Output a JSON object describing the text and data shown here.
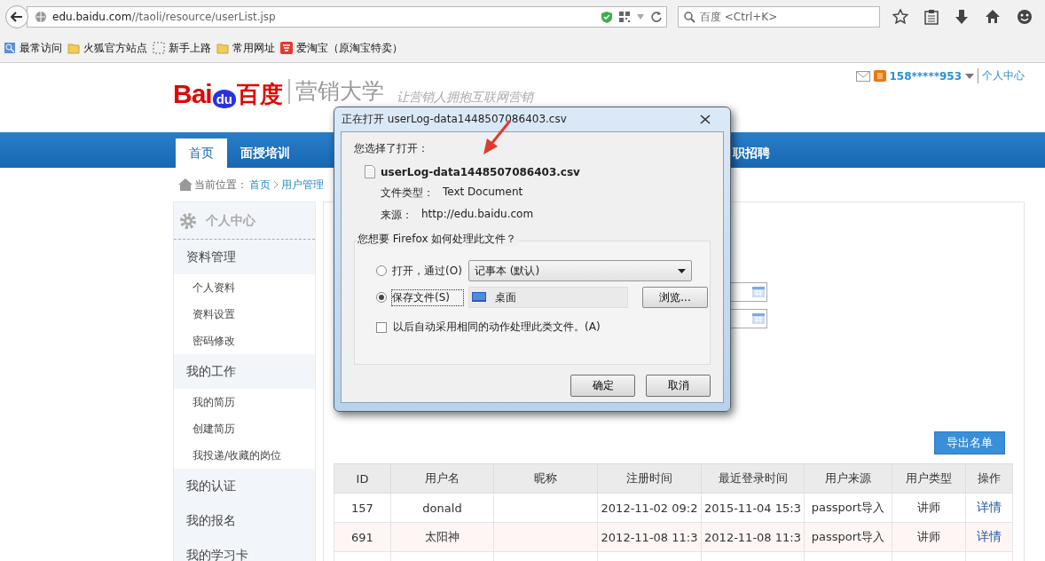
{
  "browser": {
    "url_host": "edu.baidu.com",
    "url_path": "//taoli/resource/userList.jsp",
    "search_placeholder": "百度 <Ctrl+K>",
    "bookmarks": [
      {
        "label": "最常访问",
        "kind": "smart"
      },
      {
        "label": "火狐官方站点",
        "kind": "folder"
      },
      {
        "label": "新手上路",
        "kind": "page"
      },
      {
        "label": "常用网址",
        "kind": "folder"
      },
      {
        "label": "爱淘宝（原淘宝特卖）",
        "kind": "shop"
      }
    ]
  },
  "header": {
    "logo_left": "Bai",
    "logo_paw": "du",
    "logo_right": "百度",
    "site": "营销大学",
    "slogan": "让营销人拥抱互联网营销",
    "user": "158*****953",
    "user_center": "个人中心"
  },
  "nav": [
    {
      "label": "首页",
      "selected": true
    },
    {
      "label": "面授培训",
      "selected": false
    },
    {
      "label": "职招聘",
      "selected": false
    }
  ],
  "breadcrumb": {
    "label": "当前位置：",
    "links": [
      "首页",
      "用户管理"
    ]
  },
  "sidebar": {
    "title": "个人中心",
    "groups": [
      {
        "label": "资料管理",
        "children": [
          "个人资料",
          "资料设置",
          "密码修改"
        ]
      },
      {
        "label": "我的工作",
        "children": [
          "我的简历",
          "创建简历",
          "我投递/收藏的岗位"
        ]
      },
      {
        "label": "我的认证"
      },
      {
        "label": "我的报名"
      },
      {
        "label": "我的学习卡"
      }
    ]
  },
  "export_button": "导出名单",
  "table": {
    "columns": [
      "ID",
      "用户名",
      "昵称",
      "注册时间",
      "最近登录时间",
      "用户来源",
      "用户类型",
      "操作"
    ],
    "rows": [
      {
        "cells": [
          "157",
          "donald",
          "",
          "2012-11-02 09:2",
          "2015-11-04 15:3",
          "passport导入",
          "讲师"
        ],
        "action": "详情"
      },
      {
        "cells": [
          "691",
          "太阳神",
          "",
          "2012-11-08 11:3",
          "2012-11-08 11:3",
          "passport导入",
          "讲师"
        ],
        "action": "详情"
      }
    ]
  },
  "dialog": {
    "title": "正在打开 userLog-data1448507086403.csv",
    "prompt": "您选择了打开：",
    "filename": "userLog-data1448507086403.csv",
    "type_label": "文件类型：",
    "type_value": "Text Document",
    "source_label": "来源：",
    "source_value": "http://edu.baidu.com",
    "question": "您想要 Firefox 如何处理此文件？",
    "options": [
      {
        "label": "打开，通过(O)",
        "selected": false,
        "kind": "dropdown",
        "value": "记事本 (默认)"
      },
      {
        "label": "保存文件(S)",
        "selected": true,
        "kind": "folder",
        "value": "桌面"
      }
    ],
    "browse": "浏览...",
    "remember": {
      "label": "以后自动采用相同的动作处理此类文件。(A)",
      "checked": false
    },
    "buttons": [
      "确定",
      "取消"
    ]
  }
}
